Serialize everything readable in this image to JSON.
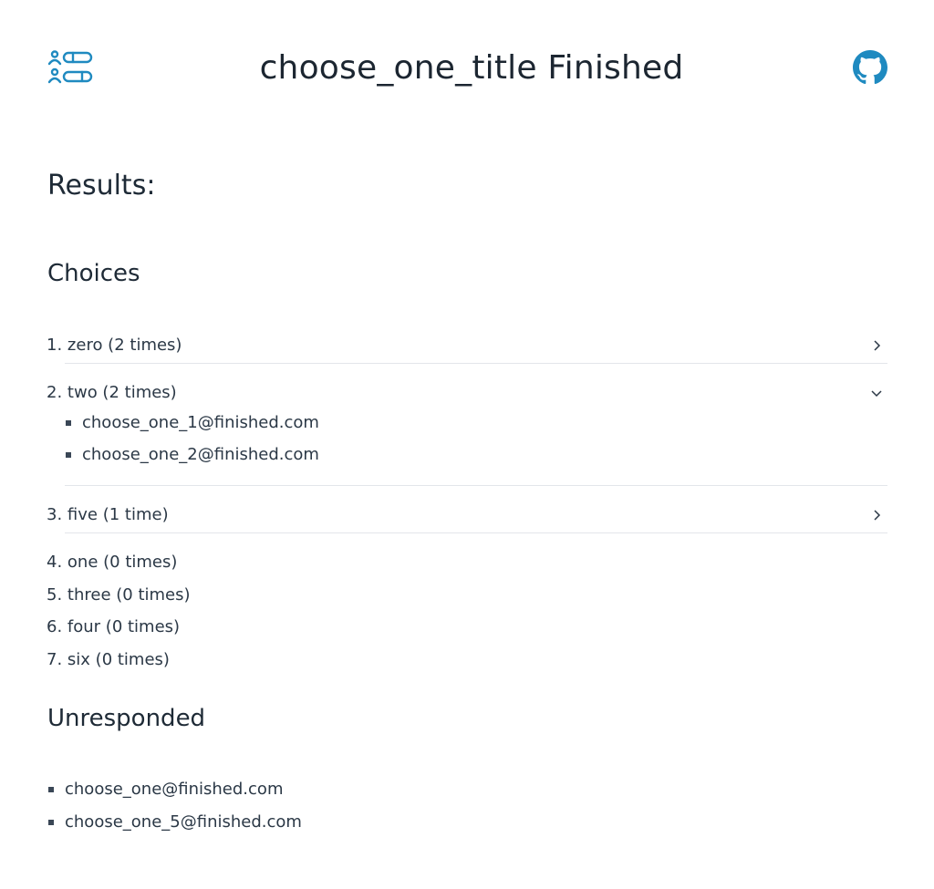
{
  "header": {
    "title": "choose_one_title Finished",
    "logo_icon": "user-list-icon",
    "github_icon": "github-icon",
    "accent_color": "#1f8ac0"
  },
  "results_heading": "Results:",
  "choices": {
    "heading": "Choices",
    "items": [
      {
        "number": "1.",
        "label": "zero (2 times)",
        "expanded": false,
        "responders": []
      },
      {
        "number": "2.",
        "label": "two (2 times)",
        "expanded": true,
        "responders": [
          "choose_one_1@finished.com",
          "choose_one_2@finished.com"
        ]
      },
      {
        "number": "3.",
        "label": "five (1 time)",
        "expanded": false,
        "responders": []
      },
      {
        "number": "4.",
        "label": "one (0 times)"
      },
      {
        "number": "5.",
        "label": "three (0 times)"
      },
      {
        "number": "6.",
        "label": "four (0 times)"
      },
      {
        "number": "7.",
        "label": "six (0 times)"
      }
    ]
  },
  "unresponded": {
    "heading": "Unresponded",
    "items": [
      "choose_one@finished.com",
      "choose_one_5@finished.com"
    ]
  }
}
